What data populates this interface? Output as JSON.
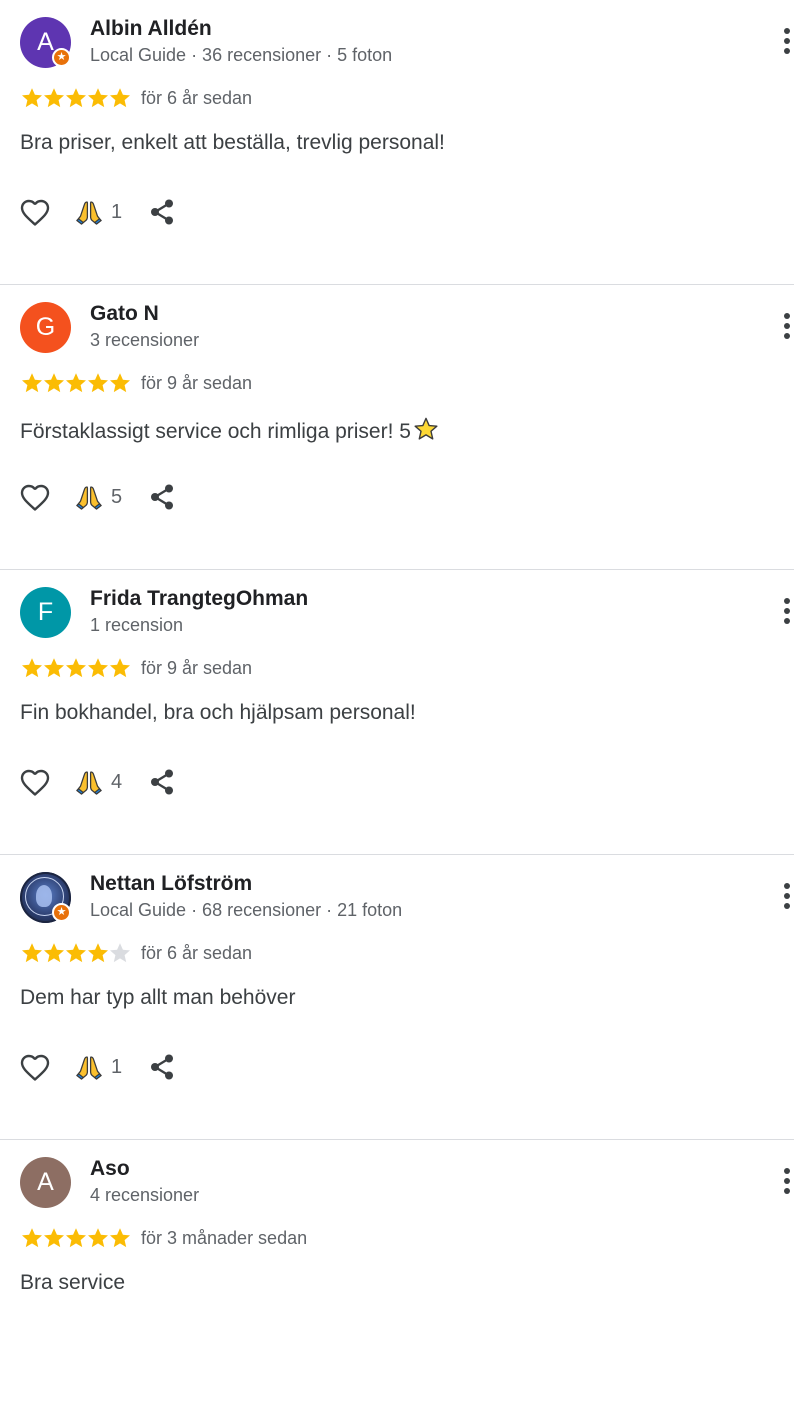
{
  "colors": {
    "star_filled": "#fbbc04",
    "star_empty": "#dadce0",
    "divider": "#dadce0",
    "local_guide_badge": "#e8710a"
  },
  "icons": {
    "star": "star-icon",
    "like": "heart-outline-icon",
    "reaction": "folded-hands-emoji-icon",
    "share": "share-icon",
    "more": "more-vert-icon",
    "local_guide": "local-guide-badge-icon"
  },
  "reviews": [
    {
      "avatar_letter": "A",
      "avatar_color": "#5e35b1",
      "avatar_photo": false,
      "local_guide": true,
      "name": "Albin Alldén",
      "meta": "Local Guide · 36 recensioner · 5 foton",
      "rating": 5,
      "date": "för 6 år sedan",
      "text": "Bra priser, enkelt att beställa, trevlig personal!",
      "text_star_emoji": false,
      "reaction_count": "1"
    },
    {
      "avatar_letter": "G",
      "avatar_color": "#f4511e",
      "avatar_photo": false,
      "local_guide": false,
      "name": "Gato N",
      "meta": "3 recensioner",
      "rating": 5,
      "date": "för 9 år sedan",
      "text": "Förstaklassigt service och rimliga priser! 5",
      "text_star_emoji": true,
      "reaction_count": "5"
    },
    {
      "avatar_letter": "F",
      "avatar_color": "#0097a7",
      "avatar_photo": false,
      "local_guide": false,
      "name": "Frida TrangtegOhman",
      "meta": "1 recension",
      "rating": 5,
      "date": "för 9 år sedan",
      "text": "Fin bokhandel, bra och hjälpsam personal!",
      "text_star_emoji": false,
      "reaction_count": "4"
    },
    {
      "avatar_letter": "",
      "avatar_color": "#2d3f70",
      "avatar_photo": true,
      "local_guide": true,
      "name": "Nettan Löfström",
      "meta": "Local Guide · 68 recensioner · 21 foton",
      "rating": 4,
      "date": "för 6 år sedan",
      "text": "Dem har typ allt man behöver",
      "text_star_emoji": false,
      "reaction_count": "1"
    },
    {
      "avatar_letter": "A",
      "avatar_color": "#8d6e63",
      "avatar_photo": false,
      "local_guide": false,
      "name": "Aso",
      "meta": "4 recensioner",
      "rating": 5,
      "date": "för 3 månader sedan",
      "text": "Bra service",
      "text_star_emoji": false,
      "reaction_count": null
    }
  ]
}
